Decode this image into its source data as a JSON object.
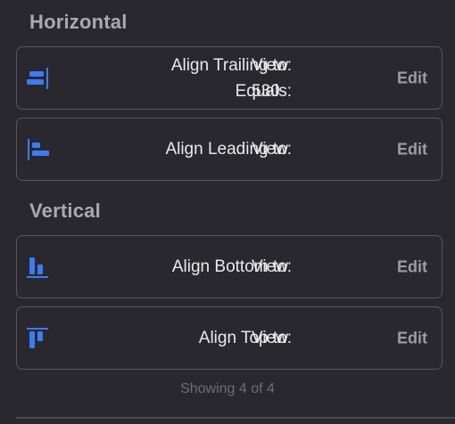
{
  "sections": {
    "horizontal": {
      "title": "Horizontal"
    },
    "vertical": {
      "title": "Vertical"
    }
  },
  "constraints": [
    {
      "icon": "align-trailing-icon",
      "label": "Align Trailing to:",
      "value": "View",
      "equals_label": "Equals:",
      "equals_value": "530",
      "action": "Edit"
    },
    {
      "icon": "align-leading-icon",
      "label": "Align Leading to:",
      "value": "View",
      "action": "Edit"
    },
    {
      "icon": "align-bottom-icon",
      "label": "Align Bottom to:",
      "value": "View",
      "action": "Edit"
    },
    {
      "icon": "align-top-icon",
      "label": "Align Top to:",
      "value": "View",
      "action": "Edit"
    }
  ],
  "footer": {
    "text": "Showing 4 of 4"
  },
  "colors": {
    "accent": "#3d7bf5",
    "background": "#29282e",
    "border": "#57565c"
  }
}
